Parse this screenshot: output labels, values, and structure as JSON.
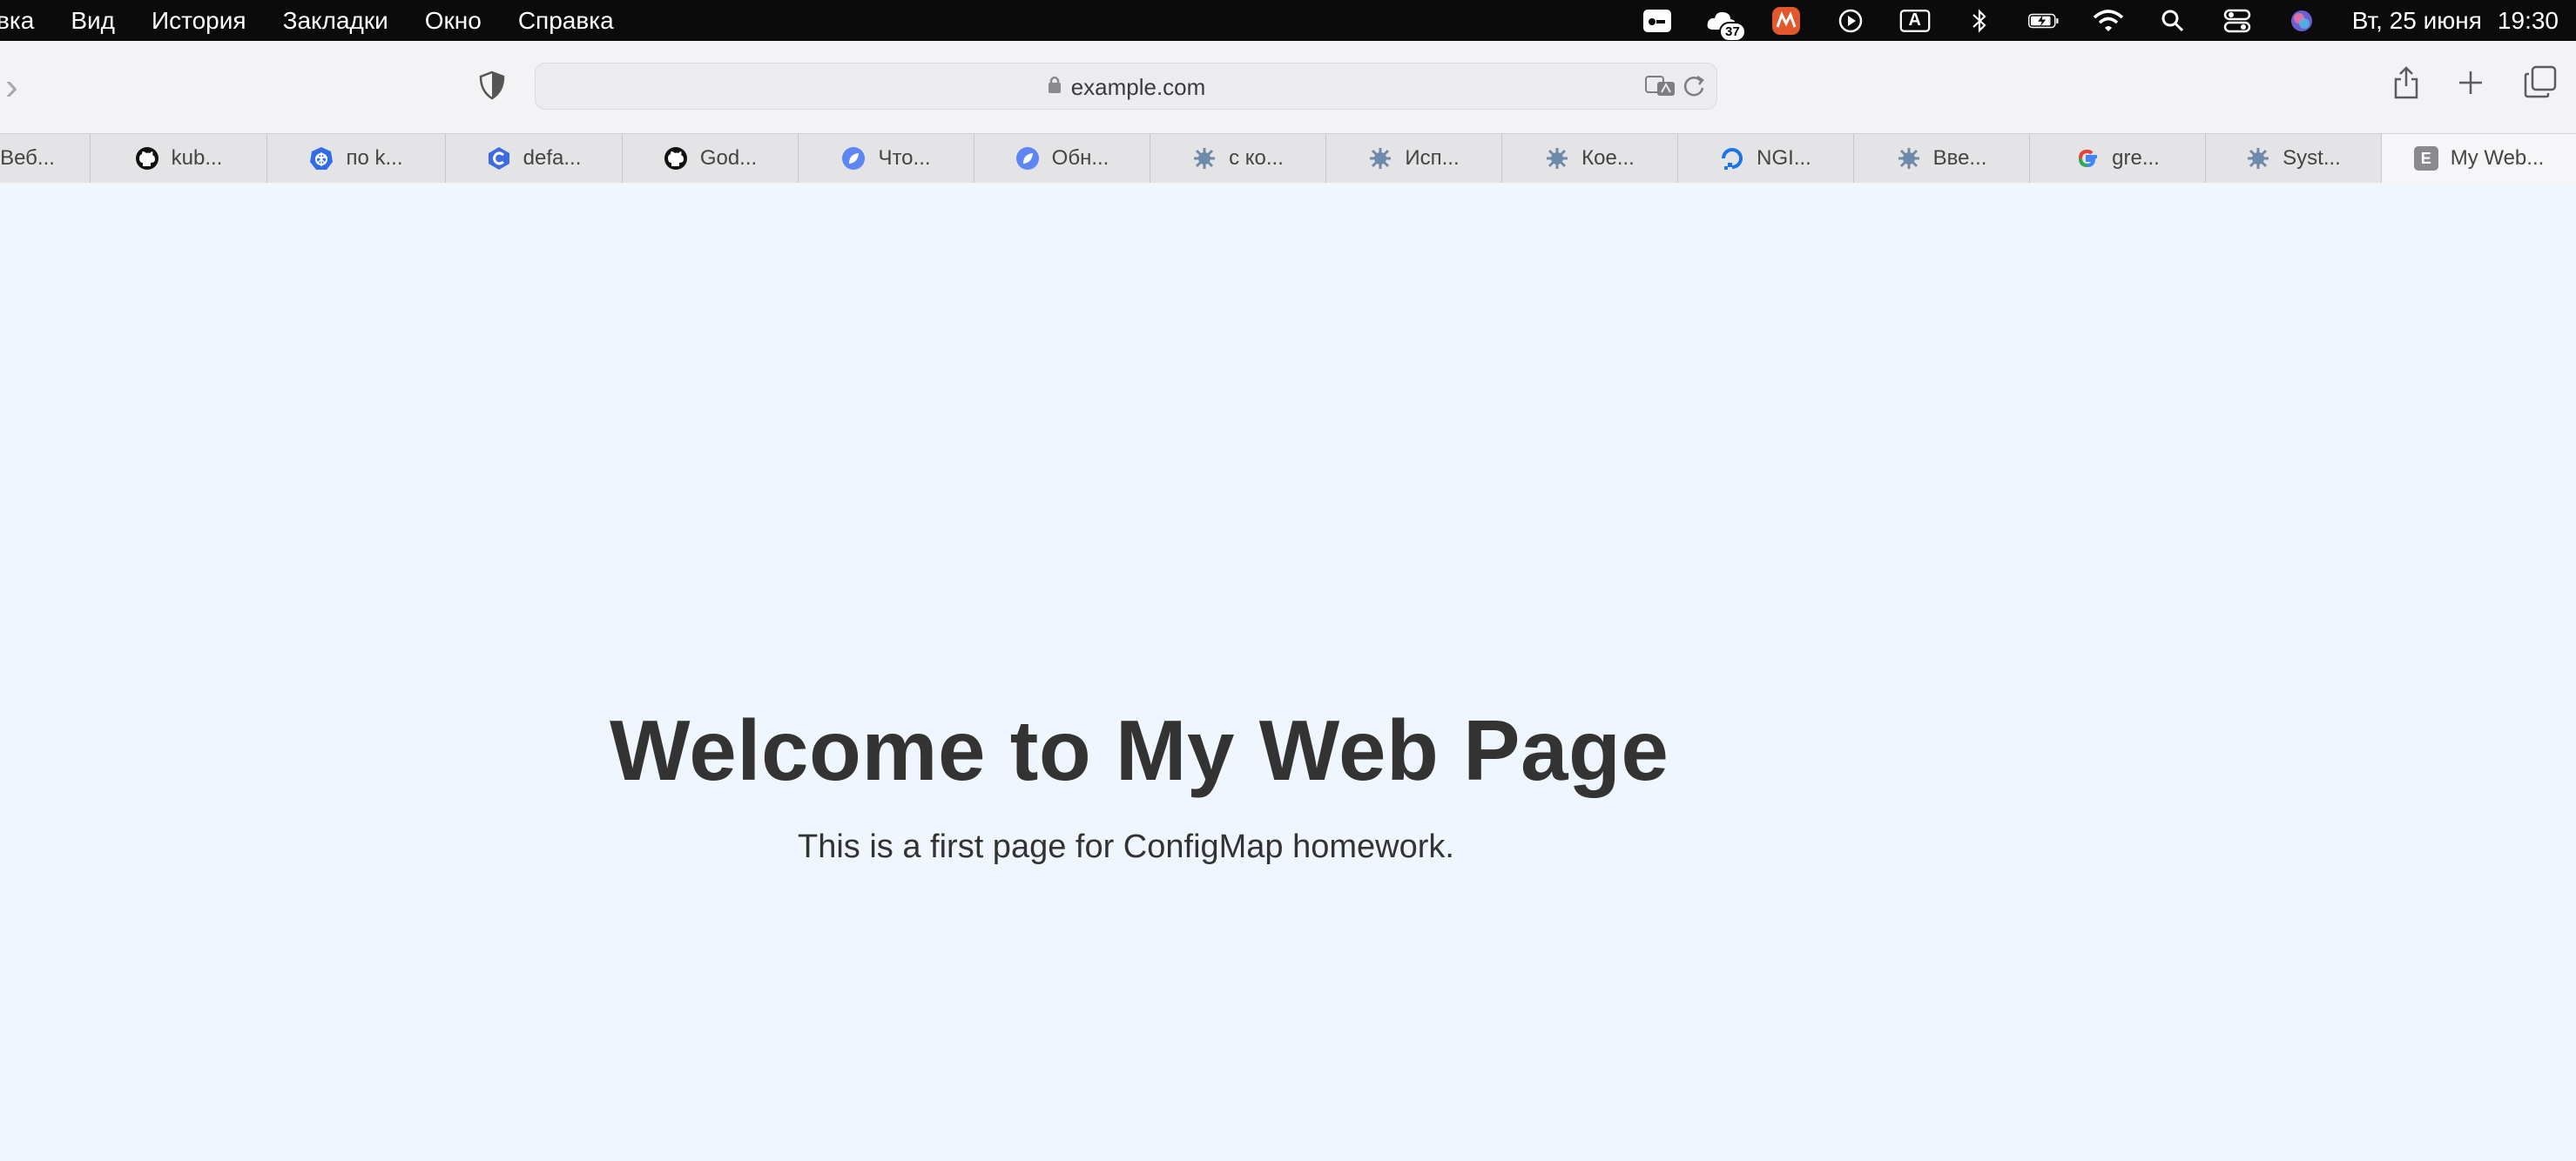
{
  "menubar": {
    "items": [
      "вка",
      "Вид",
      "История",
      "Закладки",
      "Окно",
      "Справка"
    ],
    "date": "Вт, 25 июня",
    "time": "19:30",
    "badge_count": "37",
    "input_source": "A"
  },
  "toolbar": {
    "url": "example.com"
  },
  "tabs": [
    {
      "label": "Веб...",
      "icon": "generic-icon"
    },
    {
      "label": "kub...",
      "icon": "github-icon"
    },
    {
      "label": "по k...",
      "icon": "kubernetes-icon"
    },
    {
      "label": "defa...",
      "icon": "cursor-c-icon"
    },
    {
      "label": "God...",
      "icon": "github-icon"
    },
    {
      "label": "Что...",
      "icon": "leaf-icon"
    },
    {
      "label": "Обн...",
      "icon": "leaf-icon"
    },
    {
      "label": "с ко...",
      "icon": "gear-icon"
    },
    {
      "label": "Исп...",
      "icon": "gear-icon"
    },
    {
      "label": "Кое...",
      "icon": "gear-icon"
    },
    {
      "label": "NGI...",
      "icon": "digitalocean-icon"
    },
    {
      "label": "Вве...",
      "icon": "gear-icon"
    },
    {
      "label": "gre...",
      "icon": "google-icon"
    },
    {
      "label": "Syst...",
      "icon": "gear-icon"
    },
    {
      "label": "My Web...",
      "icon": "letter-e-icon",
      "letter": "E"
    }
  ],
  "page": {
    "heading": "Welcome to My Web Page",
    "paragraph": "This is a first page for ConfigMap homework."
  }
}
